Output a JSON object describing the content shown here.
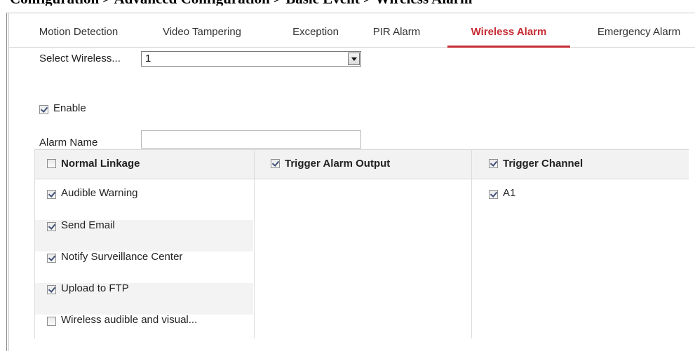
{
  "document": {
    "heading": "Configuration > Advanced Configuration > Basic Event > Wireless Alarm"
  },
  "tabs": [
    {
      "label": "Motion Detection",
      "active": false
    },
    {
      "label": "Video Tampering",
      "active": false
    },
    {
      "label": "Exception",
      "active": false
    },
    {
      "label": "PIR Alarm",
      "active": false
    },
    {
      "label": "Wireless Alarm",
      "active": true
    },
    {
      "label": "Emergency Alarm",
      "active": false
    }
  ],
  "form": {
    "select_label": "Select Wireless...",
    "select_value": "1",
    "enable_label": "Enable",
    "enable_checked": true,
    "alarm_name_label": "Alarm Name",
    "alarm_name_value": "",
    "alarm_name_placeholder": ""
  },
  "linkage": {
    "columns": [
      {
        "label": "Normal Linkage",
        "checked": false
      },
      {
        "label": "Trigger Alarm Output",
        "checked": true
      },
      {
        "label": "Trigger Channel",
        "checked": true
      }
    ],
    "normal_linkage_items": [
      {
        "label": "Audible Warning",
        "checked": true
      },
      {
        "label": "Send Email",
        "checked": true
      },
      {
        "label": "Notify Surveillance Center",
        "checked": true
      },
      {
        "label": "Upload to FTP",
        "checked": true
      },
      {
        "label": "Wireless audible and visual...",
        "checked": false
      }
    ],
    "trigger_channel_items": [
      {
        "label": "A1",
        "checked": true
      }
    ]
  },
  "colors": {
    "accent": "#c72b34",
    "header_bg": "#f2f2f2",
    "stripe_bg": "#f3f3f3"
  }
}
